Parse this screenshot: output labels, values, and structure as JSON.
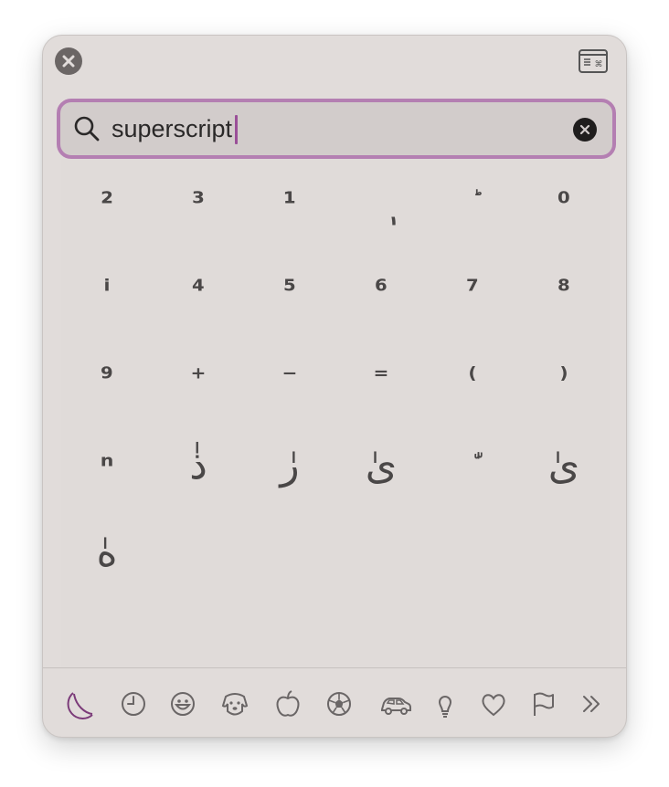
{
  "search": {
    "value": "superscript",
    "placeholder": "Search"
  },
  "results": [
    {
      "char": "²",
      "name": "superscript-two",
      "cls": ""
    },
    {
      "char": "³",
      "name": "superscript-three",
      "cls": ""
    },
    {
      "char": "¹",
      "name": "superscript-one",
      "cls": ""
    },
    {
      "char": "ٖ",
      "name": "arabic-subscript-alef",
      "cls": "arabic"
    },
    {
      "char": "ؕ",
      "name": "arabic-small-high-mark",
      "cls": "small"
    },
    {
      "char": "⁰",
      "name": "superscript-zero",
      "cls": ""
    },
    {
      "char": "ⁱ",
      "name": "superscript-latin-i",
      "cls": ""
    },
    {
      "char": "⁴",
      "name": "superscript-four",
      "cls": ""
    },
    {
      "char": "⁵",
      "name": "superscript-five",
      "cls": ""
    },
    {
      "char": "⁶",
      "name": "superscript-six",
      "cls": ""
    },
    {
      "char": "⁷",
      "name": "superscript-seven",
      "cls": ""
    },
    {
      "char": "⁸",
      "name": "superscript-eight",
      "cls": ""
    },
    {
      "char": "⁹",
      "name": "superscript-nine",
      "cls": ""
    },
    {
      "char": "⁺",
      "name": "superscript-plus",
      "cls": ""
    },
    {
      "char": "⁻",
      "name": "superscript-minus",
      "cls": ""
    },
    {
      "char": "⁼",
      "name": "superscript-equals",
      "cls": ""
    },
    {
      "char": "⁽",
      "name": "superscript-left-paren",
      "cls": ""
    },
    {
      "char": "⁾",
      "name": "superscript-right-paren",
      "cls": ""
    },
    {
      "char": "ⁿ",
      "name": "superscript-latin-n",
      "cls": ""
    },
    {
      "char": "ذٰ",
      "name": "thal-superscript-alef",
      "cls": "arabic"
    },
    {
      "char": "رٰ",
      "name": "reh-superscript-alef",
      "cls": "arabic"
    },
    {
      "char": "ىٰ",
      "name": "alef-maksura-superscript-alef",
      "cls": "arabic"
    },
    {
      "char": "ّٰ",
      "name": "shadda-superscript-alef",
      "cls": "small"
    },
    {
      "char": "ىٰ",
      "name": "alef-maksura-superscript-alef-isolated",
      "cls": "arabic"
    },
    {
      "char": "هٰ",
      "name": "heh-superscript-alef",
      "cls": "arabic"
    }
  ],
  "categories": [
    {
      "name": "tab-frequently-used",
      "icon": "moon-symbol-icon",
      "active": true
    },
    {
      "name": "tab-recents",
      "icon": "clock-icon",
      "active": false
    },
    {
      "name": "tab-smileys",
      "icon": "smiley-icon",
      "active": false
    },
    {
      "name": "tab-animals",
      "icon": "dog-icon",
      "active": false
    },
    {
      "name": "tab-food",
      "icon": "apple-icon",
      "active": false
    },
    {
      "name": "tab-activity",
      "icon": "soccer-ball-icon",
      "active": false
    },
    {
      "name": "tab-travel",
      "icon": "car-icon",
      "active": false
    },
    {
      "name": "tab-objects",
      "icon": "lightbulb-icon",
      "active": false
    },
    {
      "name": "tab-symbols",
      "icon": "heart-icon",
      "active": false
    },
    {
      "name": "tab-flags",
      "icon": "flag-icon",
      "active": false
    },
    {
      "name": "tab-more",
      "icon": "chevron-double-right-icon",
      "active": false
    }
  ],
  "colors": {
    "panel": "#e1dcda",
    "accent": "#b47fb2",
    "active_tab": "#7b3b79",
    "glyph": "#4a4747"
  }
}
